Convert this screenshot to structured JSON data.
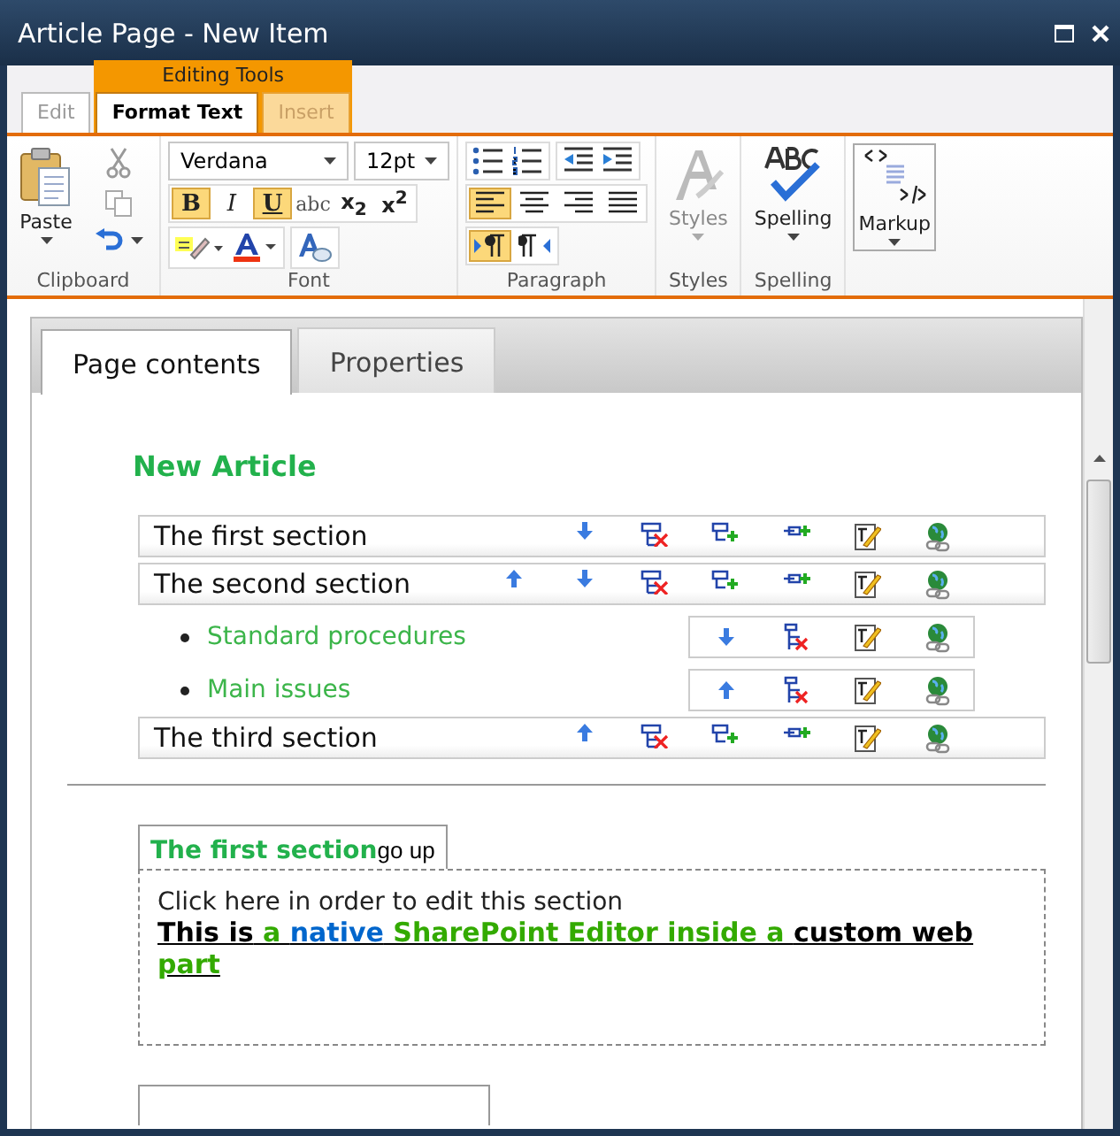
{
  "window": {
    "title": "Article Page - New Item"
  },
  "contextual_group": {
    "label": "Editing Tools"
  },
  "ribbon_tabs": [
    {
      "label": "Edit",
      "selected": false,
      "kind": "plain"
    },
    {
      "label": "Format Text",
      "selected": true,
      "kind": "contextual"
    },
    {
      "label": "Insert",
      "selected": false,
      "kind": "contextual"
    }
  ],
  "clipboard": {
    "paste": "Paste",
    "label": "Clipboard"
  },
  "font": {
    "family": "Verdana",
    "size": "12pt",
    "label": "Font",
    "buttons": [
      {
        "label": "B",
        "kind": "bold",
        "selected": true
      },
      {
        "label": "I",
        "kind": "italic",
        "selected": false
      },
      {
        "label": "U",
        "kind": "underline",
        "selected": true
      },
      {
        "label": "abc",
        "kind": "strike",
        "selected": false
      },
      {
        "label": "x$_{2}$",
        "kind": "plain",
        "selected": false
      },
      {
        "label": "x$^{2}$",
        "kind": "plain",
        "selected": false
      }
    ]
  },
  "paragraph": {
    "label": "Paragraph",
    "align": [
      {
        "kind": "left",
        "selected": true
      },
      {
        "kind": "center",
        "selected": false
      },
      {
        "kind": "right",
        "selected": false
      },
      {
        "kind": "justify",
        "selected": false
      }
    ],
    "direction": [
      {
        "kind": "ltr",
        "selected": true
      },
      {
        "kind": "rtl",
        "selected": false
      }
    ]
  },
  "styles": {
    "button": "Styles",
    "label": "Styles"
  },
  "spelling": {
    "button": "Spelling",
    "label": "Spelling"
  },
  "markup": {
    "button": "Markup"
  },
  "page_tabs": [
    {
      "label": "Page contents",
      "selected": true
    },
    {
      "label": "Properties",
      "selected": false
    }
  ],
  "article": {
    "title": "New Article",
    "sections": [
      {
        "title": "The first section",
        "actions": [
          {
            "kind": "down"
          },
          {
            "kind": "delete"
          },
          {
            "kind": "add-child"
          },
          {
            "kind": "add-sibling"
          },
          {
            "kind": "edit"
          },
          {
            "kind": "link"
          }
        ]
      },
      {
        "title": "The second section",
        "actions": [
          {
            "kind": "up"
          },
          {
            "kind": "down"
          },
          {
            "kind": "delete"
          },
          {
            "kind": "add-child"
          },
          {
            "kind": "add-sibling"
          },
          {
            "kind": "edit"
          },
          {
            "kind": "link"
          }
        ],
        "children": [
          {
            "title": "Standard procedures",
            "actions": [
              {
                "kind": "down"
              },
              {
                "kind": "delete"
              },
              {
                "kind": "edit"
              },
              {
                "kind": "link"
              }
            ]
          },
          {
            "title": "Main issues",
            "actions": [
              {
                "kind": "up"
              },
              {
                "kind": "delete"
              },
              {
                "kind": "edit"
              },
              {
                "kind": "link"
              }
            ]
          }
        ]
      },
      {
        "title": "The third section",
        "actions": [
          {
            "kind": "up"
          },
          {
            "kind": "delete"
          },
          {
            "kind": "add-child"
          },
          {
            "kind": "add-sibling"
          },
          {
            "kind": "edit"
          },
          {
            "kind": "link"
          }
        ]
      }
    ]
  },
  "editor_section": {
    "tab": "The first section",
    "go_up": "go up",
    "hint": "Click here in order to edit this section",
    "content": [
      {
        "text": "This is",
        "color": "#000000"
      },
      {
        "text": " a ",
        "color": "#33aa00"
      },
      {
        "text": "native",
        "color": "#0066cc"
      },
      {
        "text": " SharePoint Editor inside a ",
        "color": "#33aa00"
      },
      {
        "text": "custom web ",
        "color": "#000000"
      },
      {
        "text": "part",
        "color": "#33aa00"
      }
    ]
  }
}
